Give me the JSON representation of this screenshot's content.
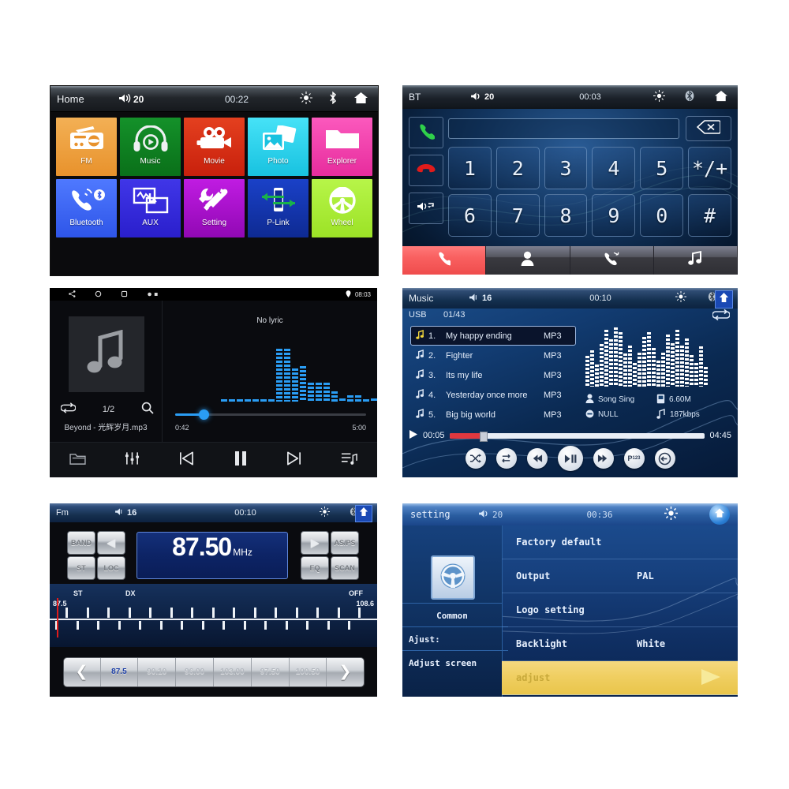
{
  "home": {
    "status": {
      "title": "Home",
      "volume": "20",
      "clock": "00:22",
      "icons": [
        "brightness-icon",
        "bluetooth-icon",
        "home-icon"
      ]
    },
    "tiles_row1": [
      {
        "label": "FM",
        "color": "#f0a13c",
        "icon": "radio-icon"
      },
      {
        "label": "Music",
        "color": "#0e7e20",
        "icon": "headphones-icon"
      },
      {
        "label": "Movie",
        "color": "#d52b14",
        "icon": "video-camera-icon"
      },
      {
        "label": "Photo",
        "color": "#2bd3ef",
        "icon": "photo-icon"
      },
      {
        "label": "Explorer",
        "color": "#ef3cab",
        "icon": "folder-icon"
      }
    ],
    "tiles_row2": [
      {
        "label": "Bluetooth",
        "color": "#3a63f0",
        "icon": "phone-bluetooth-icon"
      },
      {
        "label": "AUX",
        "color": "#3128d8",
        "icon": "aux-screens-icon"
      },
      {
        "label": "Setting",
        "color": "#a812cc",
        "icon": "tools-icon"
      },
      {
        "label": "P-Link",
        "color": "#1334b0",
        "icon": "phone-link-icon"
      },
      {
        "label": "Wheel",
        "color": "#a8ef35",
        "icon": "steering-wheel-icon"
      }
    ]
  },
  "bt": {
    "status": {
      "title": "BT",
      "volume": "20",
      "clock": "00:03",
      "icons": [
        "brightness-icon",
        "bluetooth-icon",
        "home-icon"
      ]
    },
    "number_value": "",
    "number_placeholder": "",
    "side_buttons": [
      {
        "name": "call-answer-button",
        "icon": "green-handset-icon"
      },
      {
        "name": "call-end-button",
        "icon": "red-handset-icon"
      },
      {
        "name": "audio-transfer-button",
        "icon": "speaker-swap-icon"
      }
    ],
    "delete_icon": "backspace-icon",
    "keys_row1": [
      "1",
      "2",
      "3",
      "4",
      "5",
      "*/+"
    ],
    "keys_row2": [
      "6",
      "7",
      "8",
      "9",
      "0",
      "#"
    ],
    "tabs": [
      {
        "name": "tab-dialpad",
        "icon": "handset-icon",
        "active": true
      },
      {
        "name": "tab-contacts",
        "icon": "person-icon",
        "active": false
      },
      {
        "name": "tab-calllog",
        "icon": "call-log-icon",
        "active": false
      },
      {
        "name": "tab-btmusic",
        "icon": "music-note-icon",
        "active": false
      }
    ]
  },
  "android_player": {
    "status": {
      "clock": "08:03",
      "nav_icons": [
        "share-icon",
        "circle-home-icon",
        "square-recents-icon",
        "dots-icon"
      ],
      "right_icon": "location-icon"
    },
    "album_icon": "music-note-icon",
    "repeat_icon": "repeat-icon",
    "page_indicator": "1/2",
    "search_icon": "search-icon",
    "track_name": "Beyond - 光辉岁月.mp3",
    "lyric_text": "No lyric",
    "time_current": "0:42",
    "time_total": "5:00",
    "progress_percent": 15,
    "eq_levels": [
      0,
      0,
      0,
      0,
      0,
      0,
      0,
      96,
      96,
      60,
      64,
      34,
      34,
      34,
      18,
      6,
      12,
      12,
      4,
      6,
      4,
      6,
      4,
      6,
      4,
      4
    ],
    "controls": [
      {
        "name": "folder-button",
        "icon": "folder-icon"
      },
      {
        "name": "equalizer-button",
        "icon": "sliders-icon"
      },
      {
        "name": "previous-button",
        "icon": "prev-track-icon"
      },
      {
        "name": "pause-button",
        "icon": "pause-icon"
      },
      {
        "name": "next-button",
        "icon": "next-track-icon"
      },
      {
        "name": "playlist-button",
        "icon": "playlist-icon"
      }
    ]
  },
  "music_list": {
    "status": {
      "title": "Music",
      "volume": "16",
      "clock": "00:10",
      "icons": [
        "brightness-icon",
        "bluetooth-icon",
        "home-up-icon"
      ]
    },
    "source": "USB",
    "track_count": "01/43",
    "repeat_icon": "repeat-icon",
    "tracks": [
      {
        "no": "1.",
        "name": "My happy ending",
        "format": "MP3",
        "selected": true
      },
      {
        "no": "2.",
        "name": "Fighter",
        "format": "MP3",
        "selected": false
      },
      {
        "no": "3.",
        "name": "Its my life",
        "format": "MP3",
        "selected": false
      },
      {
        "no": "4.",
        "name": "Yesterday once more",
        "format": "MP3",
        "selected": false
      },
      {
        "no": "5.",
        "name": "Big big world",
        "format": "MP3",
        "selected": false
      }
    ],
    "meta": {
      "artist": "Song Sing",
      "album": "NULL",
      "size": "6.60M",
      "bitrate": "187kbps"
    },
    "time_current": "00:05",
    "time_total": "04:45",
    "eq_levels": [
      52,
      62,
      38,
      72,
      96,
      80,
      100,
      92,
      56,
      70,
      40,
      58,
      84,
      92,
      66,
      44,
      58,
      88,
      74,
      96,
      70,
      82,
      54,
      40,
      68,
      34
    ],
    "controls": [
      {
        "name": "shuffle-button",
        "icon": "shuffle-icon"
      },
      {
        "name": "repeat-button",
        "icon": "repeat-icon"
      },
      {
        "name": "previous-button",
        "icon": "prev-track-icon"
      },
      {
        "name": "play-pause-button",
        "icon": "play-pause-icon"
      },
      {
        "name": "next-button",
        "icon": "next-track-icon"
      },
      {
        "name": "p123-button",
        "icon": "p123-icon"
      },
      {
        "name": "back-button",
        "icon": "back-arrow-icon"
      }
    ]
  },
  "fm": {
    "status": {
      "title": "Fm",
      "volume": "16",
      "clock": "00:10",
      "icons": [
        "brightness-icon",
        "bluetooth-icon",
        "home-up-icon"
      ]
    },
    "frequency": "87.50",
    "unit": "MHz",
    "left_buttons": [
      {
        "label": "BAND",
        "name": "band-button"
      },
      {
        "label": "◀",
        "name": "seek-down-button"
      },
      {
        "label": "ST",
        "name": "stereo-button"
      },
      {
        "label": "LOC",
        "name": "local-button"
      }
    ],
    "right_buttons": [
      {
        "label": "▶",
        "name": "seek-up-button"
      },
      {
        "label": "AS/PS",
        "name": "as-ps-button"
      },
      {
        "label": "EQ",
        "name": "eq-button"
      },
      {
        "label": "SCAN",
        "name": "scan-button"
      }
    ],
    "scale": {
      "st": "ST",
      "dx": "DX",
      "off": "OFF",
      "min": "87.5",
      "max": "108.6"
    },
    "presets": [
      "87.5",
      "90.10",
      "96.00",
      "103.00",
      "97.50",
      "100.50"
    ],
    "preset_active_index": 0,
    "prev_icon": "chevron-left-icon",
    "next_icon": "chevron-right-icon"
  },
  "setting": {
    "status": {
      "title": "setting",
      "volume": "20",
      "clock": "00:36",
      "icons": [
        "brightness-icon",
        "home-icon"
      ]
    },
    "sidebar": {
      "logo_icon": "steering-wheel-icon",
      "items": [
        {
          "label": "Common",
          "name": "sidebar-item-common"
        },
        {
          "label": "Ajust:",
          "name": "sidebar-item-ajust"
        },
        {
          "label": "Adjust screen",
          "name": "sidebar-item-adjust-screen"
        }
      ]
    },
    "rows": [
      {
        "key": "Factory default",
        "value": "",
        "highlight": false
      },
      {
        "key": "Output",
        "value": "PAL",
        "highlight": false
      },
      {
        "key": "Logo setting",
        "value": "",
        "highlight": false
      },
      {
        "key": "Backlight",
        "value": "White",
        "highlight": false
      },
      {
        "key": "adjust",
        "value": "",
        "highlight": true
      }
    ],
    "play_icon": "play-triangle-icon"
  }
}
